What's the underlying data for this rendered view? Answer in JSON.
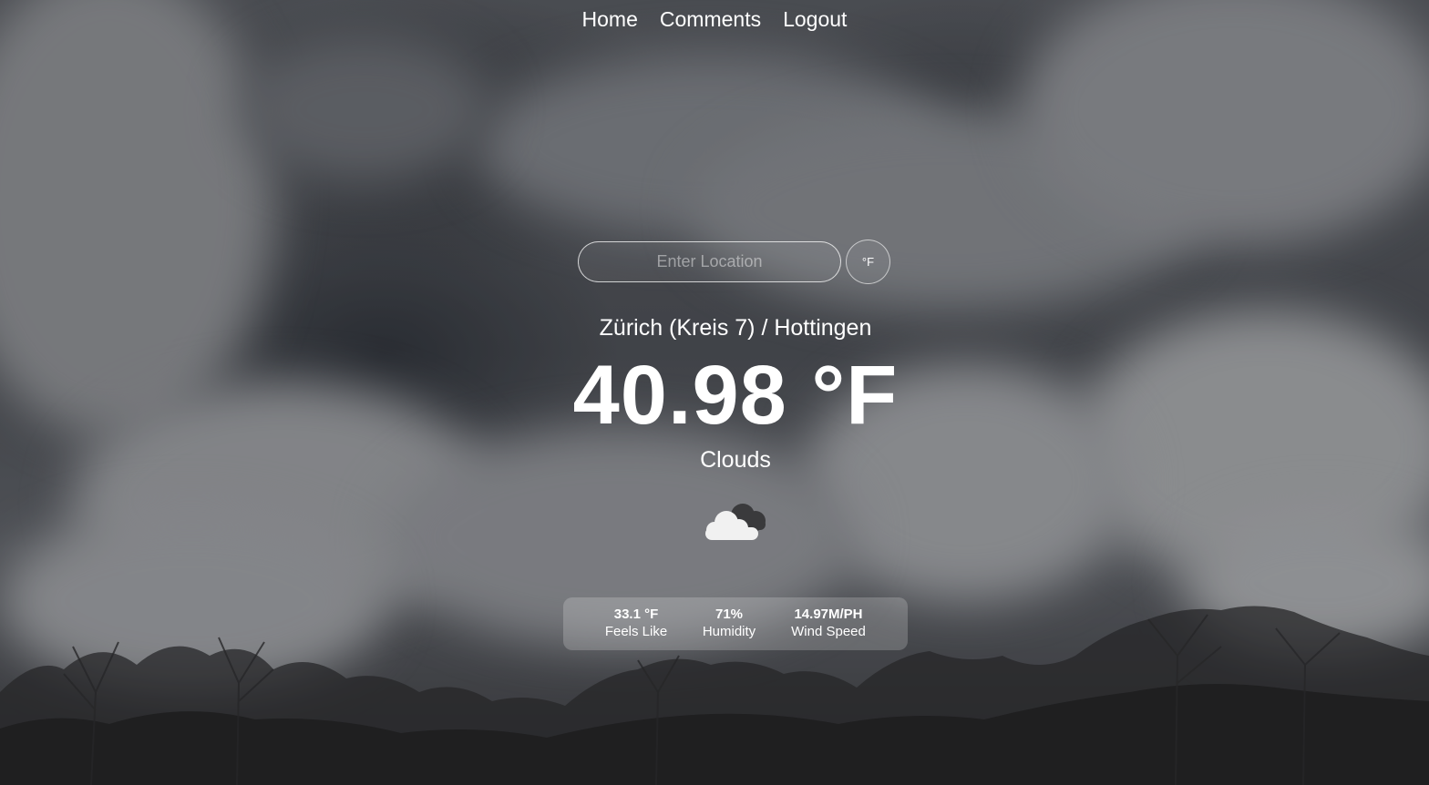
{
  "nav": {
    "home": "Home",
    "comments": "Comments",
    "logout": "Logout"
  },
  "search": {
    "placeholder": "Enter Location",
    "unit_toggle": "°F"
  },
  "weather": {
    "location": "Zürich (Kreis 7) / Hottingen",
    "temperature": "40.98 °F",
    "condition": "Clouds",
    "icon": "cloud-icon"
  },
  "stats": {
    "feels_like_value": "33.1 °F",
    "feels_like_label": "Feels Like",
    "humidity_value": "71%",
    "humidity_label": "Humidity",
    "wind_value": "14.97M/PH",
    "wind_label": "Wind Speed"
  },
  "colors": {
    "text": "#ffffff",
    "card": "rgba(255,255,255,0.2)",
    "sky": "#4e5157"
  }
}
